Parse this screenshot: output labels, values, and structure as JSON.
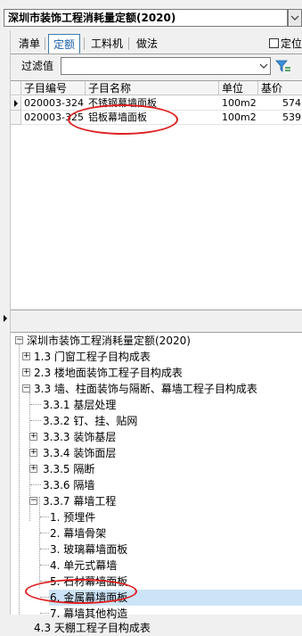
{
  "header": {
    "title": "深圳市装饰工程消耗量定额(2020)"
  },
  "tabs": [
    {
      "label": "清单"
    },
    {
      "label": "定额"
    },
    {
      "label": "工料机"
    },
    {
      "label": "做法"
    }
  ],
  "options": {
    "fix_label": "定位"
  },
  "filter": {
    "label": "过滤值",
    "value": ""
  },
  "grid": {
    "columns": [
      "子目编号",
      "子目名称",
      "单位",
      "基价"
    ],
    "rows": [
      {
        "code": "020003-324",
        "name": "不锈钢幕墙面板",
        "unit": "100m2",
        "price": "574"
      },
      {
        "code": "020003-325",
        "name": "铝板幕墙面板",
        "unit": "100m2",
        "price": "539"
      }
    ]
  },
  "tree": {
    "root": "深圳市装饰工程消耗量定额(2020)",
    "items": [
      {
        "label": "1.3 门窗工程子目构成表"
      },
      {
        "label": "2.3 楼地面装饰工程子目构成表"
      },
      {
        "label": "3.3 墙、柱面装饰与隔断、幕墙工程子目构成表"
      },
      {
        "label": "3.3.1 基层处理"
      },
      {
        "label": "3.3.2 钉、挂、贴网"
      },
      {
        "label": "3.3.3 装饰基层"
      },
      {
        "label": "3.3.4 装饰面层"
      },
      {
        "label": "3.3.5 隔断"
      },
      {
        "label": "3.3.6 隔墙"
      },
      {
        "label": "3.3.7 幕墙工程"
      },
      {
        "label": "1. 预埋件"
      },
      {
        "label": "2. 幕墙骨架"
      },
      {
        "label": "3. 玻璃幕墙面板"
      },
      {
        "label": "4. 单元式幕墙"
      },
      {
        "label": "5. 石材幕墙面板"
      },
      {
        "label": "6. 金属幕墙面板"
      },
      {
        "label": "7. 幕墙其他构造"
      },
      {
        "label": "4.3 天棚工程子目构成表"
      }
    ]
  }
}
